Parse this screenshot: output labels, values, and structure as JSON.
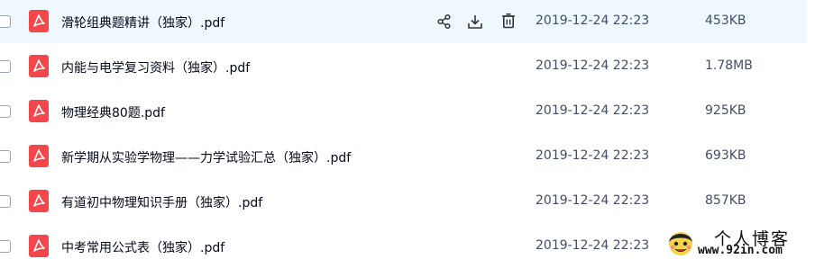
{
  "files": [
    {
      "name": "滑轮组典题精讲（独家）.pdf",
      "date": "2019-12-24 22:23",
      "size": "453KB",
      "hovered": true
    },
    {
      "name": "内能与电学复习资料（独家）.pdf",
      "date": "2019-12-24 22:23",
      "size": "1.78MB"
    },
    {
      "name": "物理经典80题.pdf",
      "date": "2019-12-24 22:23",
      "size": "925KB"
    },
    {
      "name": "新学期从实验学物理——力学试验汇总（独家）.pdf",
      "date": "2019-12-24 22:23",
      "size": "693KB"
    },
    {
      "name": "有道初中物理知识手册（独家）.pdf",
      "date": "2019-12-24 22:23",
      "size": "857KB"
    },
    {
      "name": "中考常用公式表（独家）.pdf",
      "date": "2019-12-24 22:23",
      "size": ""
    }
  ],
  "icons": {
    "file": "pdf-file-icon",
    "share": "share-icon",
    "download": "download-icon",
    "delete": "trash-icon"
  },
  "colors": {
    "pdf_red": "#f4474c",
    "hover_bg": "#eef8fe",
    "text": "#03081a",
    "meta_text": "#424e67"
  },
  "watermark": {
    "title": "个人博客",
    "url": "www.92in.com"
  }
}
